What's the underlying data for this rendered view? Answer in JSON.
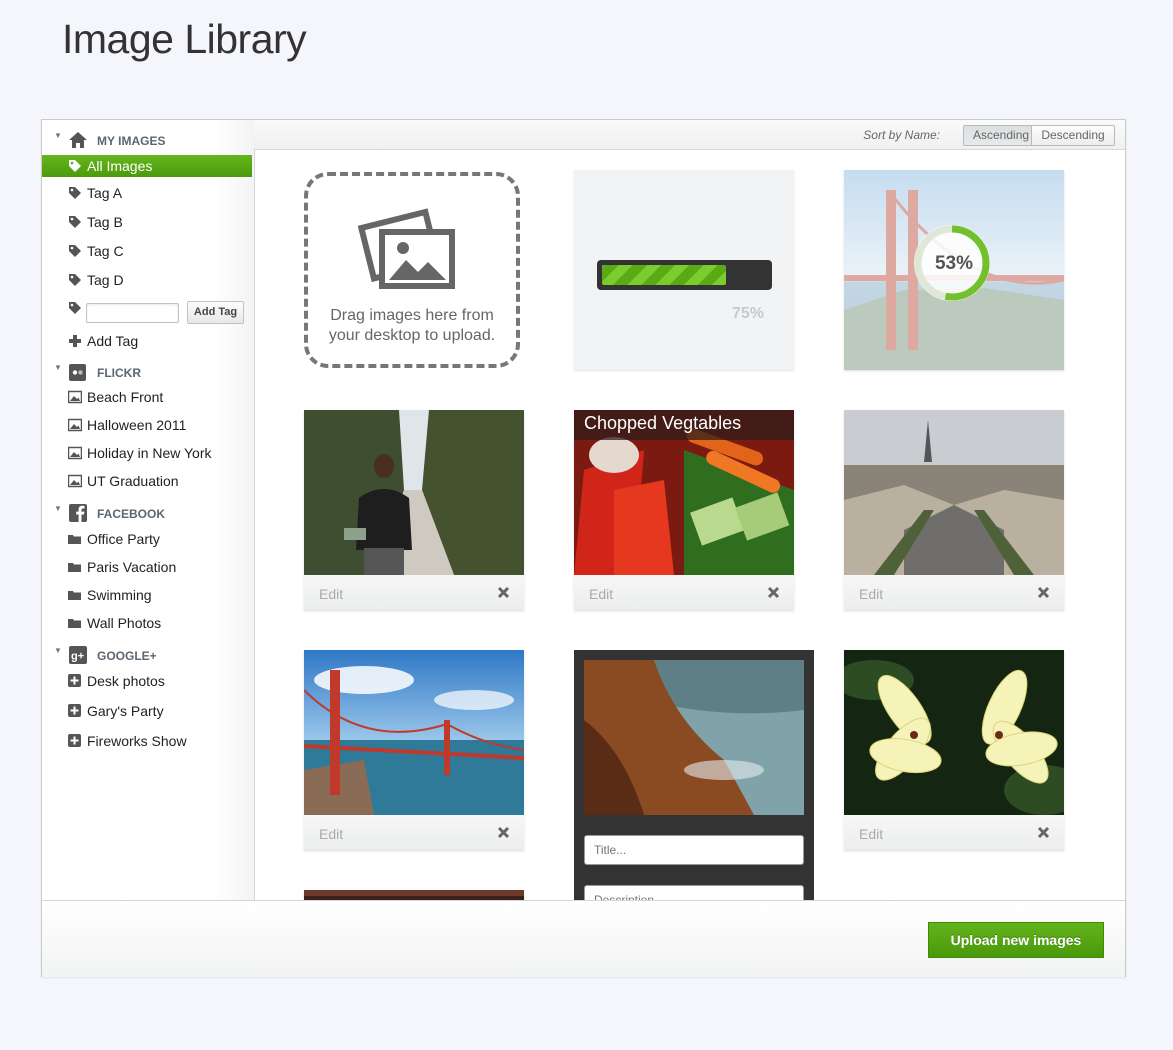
{
  "page": {
    "title": "Image Library"
  },
  "sidebar": {
    "sections": [
      {
        "label": "MY IMAGES",
        "icon": "home-icon",
        "items": [
          {
            "label": "All Images",
            "icon": "tag-icon",
            "active": true
          },
          {
            "label": "Tag A",
            "icon": "tag-icon"
          },
          {
            "label": "Tag B",
            "icon": "tag-icon"
          },
          {
            "label": "Tag C",
            "icon": "tag-icon"
          },
          {
            "label": "Tag D",
            "icon": "tag-icon"
          }
        ],
        "add_tag_button": "Add Tag",
        "add_tag_link": "Add Tag"
      },
      {
        "label": "FLICKR",
        "icon": "flickr-icon",
        "items": [
          {
            "label": "Beach Front",
            "icon": "image-icon"
          },
          {
            "label": "Halloween 2011",
            "icon": "image-icon"
          },
          {
            "label": "Holiday in New York",
            "icon": "image-icon"
          },
          {
            "label": "UT Graduation",
            "icon": "image-icon"
          }
        ]
      },
      {
        "label": "FACEBOOK",
        "icon": "facebook-icon",
        "items": [
          {
            "label": "Office Party",
            "icon": "folder-icon"
          },
          {
            "label": "Paris Vacation",
            "icon": "folder-icon"
          },
          {
            "label": "Swimming",
            "icon": "folder-icon"
          },
          {
            "label": "Wall Photos",
            "icon": "folder-icon"
          }
        ]
      },
      {
        "label": "GOOGLE+",
        "icon": "google-plus-icon",
        "items": [
          {
            "label": "Desk photos",
            "icon": "plus-box-icon"
          },
          {
            "label": "Gary's Party",
            "icon": "plus-box-icon"
          },
          {
            "label": "Fireworks Show",
            "icon": "plus-box-icon"
          }
        ]
      }
    ]
  },
  "toolbar": {
    "sort_label": "Sort by Name:",
    "ascending": "Ascending",
    "descending": "Descending",
    "selected": "Ascending"
  },
  "upload": {
    "dropzone_text": "Drag images here from your desktop to upload.",
    "progress_percent": 75,
    "progress_label": "75%",
    "circle_percent": 53,
    "circle_label": "53%"
  },
  "cards": {
    "edit_label": "Edit",
    "vegetables_title": "Chopped Vegtables"
  },
  "editor": {
    "title_placeholder": "Title...",
    "description_placeholder": "Description..."
  },
  "footer": {
    "upload_button": "Upload new images"
  },
  "colors": {
    "accent": "#55a712",
    "dark": "#333333"
  }
}
